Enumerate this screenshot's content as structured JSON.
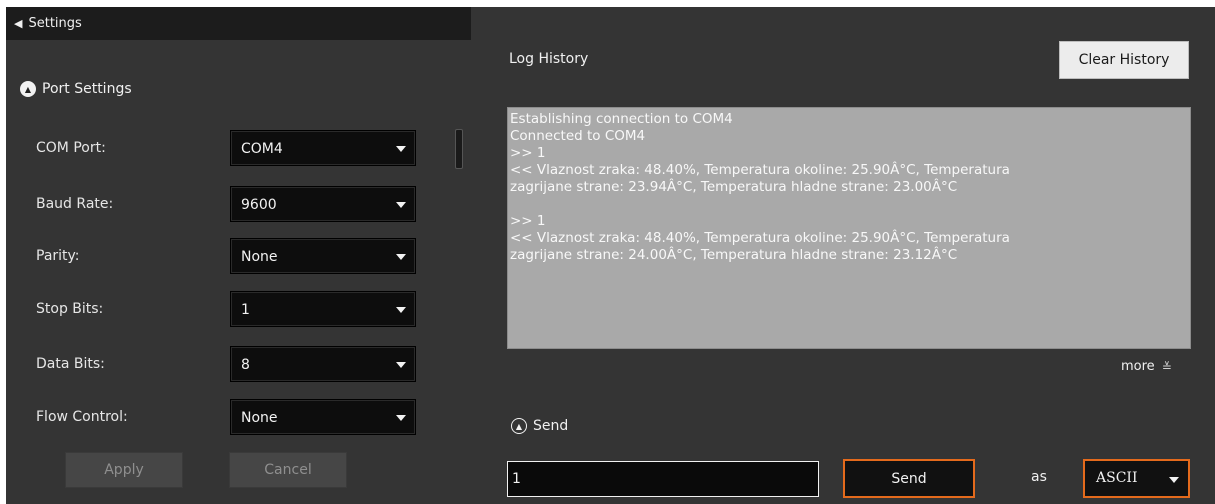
{
  "settings_bar": {
    "label": "Settings"
  },
  "port_settings": {
    "title": "Port Settings",
    "rows": [
      {
        "label": "COM Port:",
        "value": "COM4"
      },
      {
        "label": "Baud Rate:",
        "value": "9600"
      },
      {
        "label": "Parity:",
        "value": "None"
      },
      {
        "label": "Stop Bits:",
        "value": "1"
      },
      {
        "label": "Data Bits:",
        "value": "8"
      },
      {
        "label": "Flow Control:",
        "value": "None"
      }
    ],
    "apply_label": "Apply",
    "cancel_label": "Cancel"
  },
  "log": {
    "title": "Log History",
    "clear_label": "Clear History",
    "text": "Establishing connection to COM4\nConnected to COM4\n>> 1\n<< Vlaznost zraka: 48.40%, Temperatura okoline: 25.90Â°C, Temperatura\nzagrijane strane: 23.94Â°C, Temperatura hladne strane: 23.00Â°C\n\n>> 1\n<< Vlaznost zraka: 48.40%, Temperatura okoline: 25.90Â°C, Temperatura\nzagrijane strane: 24.00Â°C, Temperatura hladne strane: 23.12Â°C",
    "more_label": "more"
  },
  "send": {
    "title": "Send",
    "input_value": "1",
    "button_label": "Send",
    "as_label": "as",
    "format_value": "ASCII"
  },
  "colors": {
    "accent": "#e46a1c",
    "panel": "#343434",
    "topbar": "#1c1c1c",
    "log_bg": "#a9a9a9"
  },
  "icons": {
    "back": "triangle-left-icon",
    "collapse": "chevron-up-circle-icon",
    "more": "double-chevron-down-icon"
  }
}
